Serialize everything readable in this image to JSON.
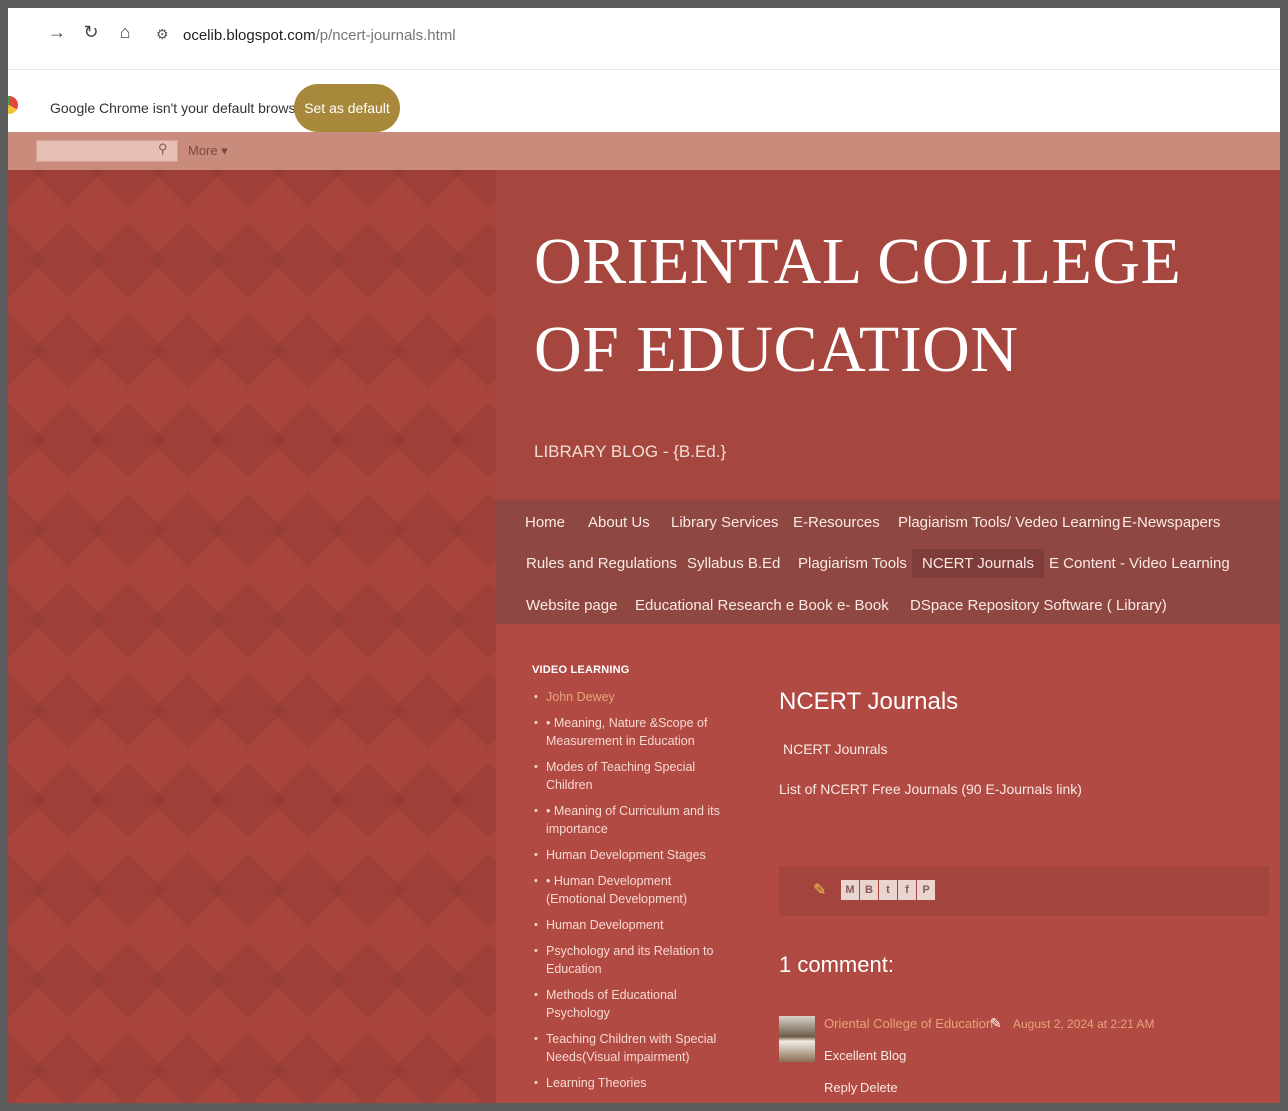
{
  "browser": {
    "url_domain": "ocelib.blogspot.com",
    "url_path": "/p/ncert-journals.html",
    "infobar_text": "Google Chrome isn't your default browser",
    "set_default_label": "Set as default"
  },
  "navbar": {
    "search_placeholder": "",
    "more_label": "More ▾"
  },
  "blog": {
    "title": "ORIENTAL COLLEGE OF EDUCATION",
    "description": "LIBRARY BLOG - {B.Ed.}"
  },
  "tabs": [
    {
      "label": "Home"
    },
    {
      "label": "About Us"
    },
    {
      "label": "Library Services"
    },
    {
      "label": "E-Resources"
    },
    {
      "label": "Plagiarism Tools/ Vedeo Learning"
    },
    {
      "label": "E-Newspapers"
    },
    {
      "label": "Rules and Regulations"
    },
    {
      "label": "Syllabus B.Ed"
    },
    {
      "label": "Plagiarism Tools"
    },
    {
      "label": "NCERT Journals",
      "selected": true
    },
    {
      "label": "E Content - Video Learning"
    },
    {
      "label": "Website page"
    },
    {
      "label": "Educational Research e Book"
    },
    {
      "label": "e- Book"
    },
    {
      "label": "DSpace Repository Software ( Library)"
    }
  ],
  "sidebar": {
    "title": "VIDEO LEARNING",
    "items": [
      "John Dewey",
      "• Meaning, Nature &Scope of Measurement in Education",
      "Modes of Teaching Special Children",
      "• Meaning of Curriculum and its importance",
      "Human Development Stages",
      "• Human Development (Emotional Development)",
      "Human Development",
      "Psychology and its Relation to Education",
      "Methods of Educational Psychology",
      "Teaching Children with Special Needs(Visual impairment)",
      "Learning Theories"
    ]
  },
  "post": {
    "title": "NCERT Journals",
    "line1": "NCERT Jounrals",
    "line2": "List of NCERT Free Journals (90 E-Journals link)",
    "share_buttons": [
      "M",
      "B",
      "t",
      "f",
      "P"
    ]
  },
  "comments": {
    "title": "1 comment:",
    "items": [
      {
        "author": "Oriental College of Education",
        "date": "August 2, 2024 at 2:21 AM",
        "text": "Excellent Blog",
        "reply_label": "Reply",
        "delete_label": "Delete"
      }
    ]
  }
}
